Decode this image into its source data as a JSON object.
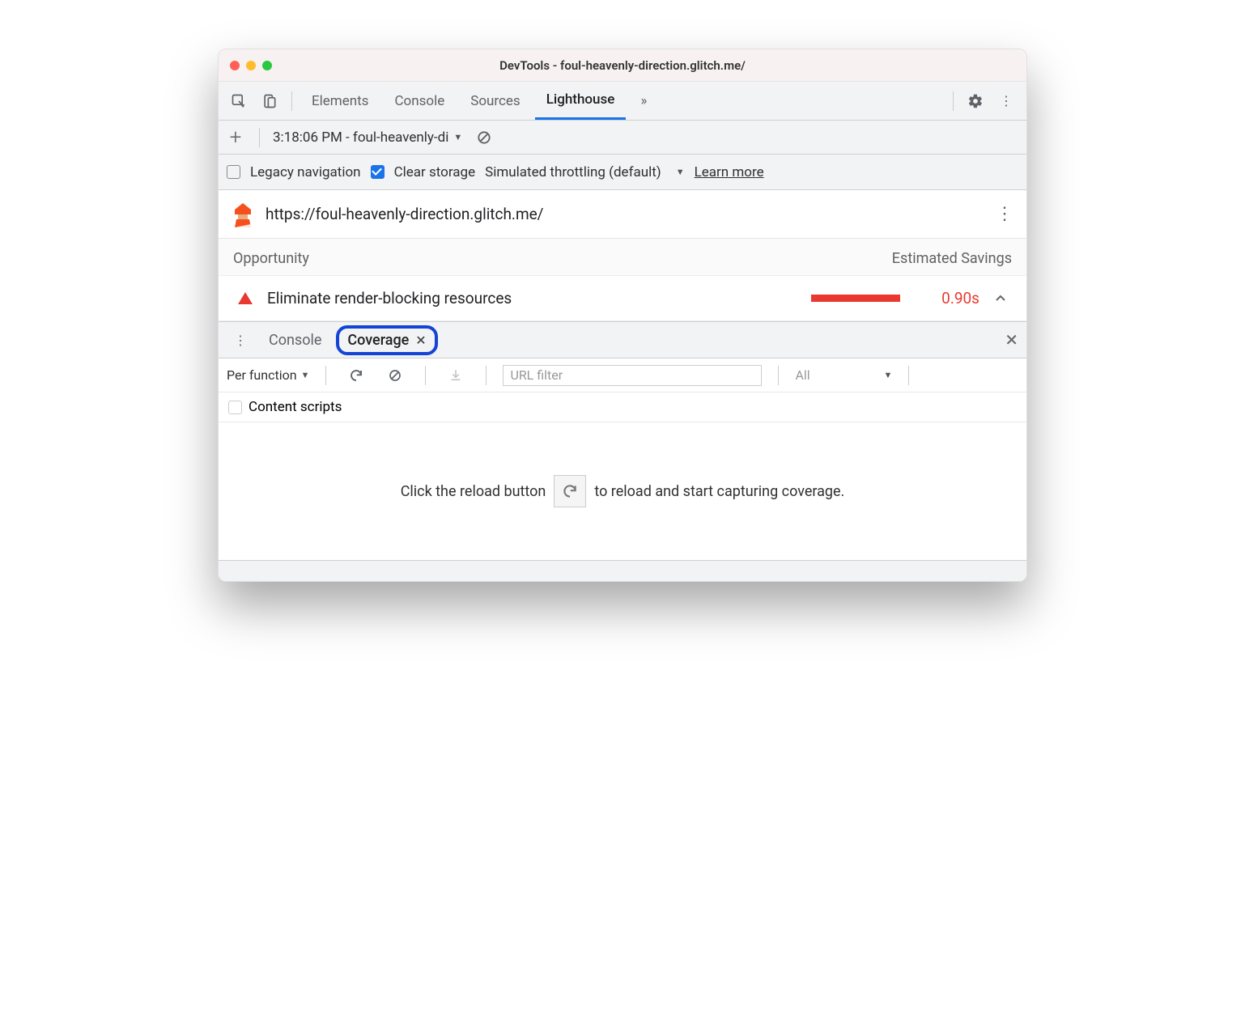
{
  "window_title": "DevTools - foul-heavenly-direction.glitch.me/",
  "tabs": {
    "elements": "Elements",
    "console": "Console",
    "sources": "Sources",
    "lighthouse": "Lighthouse"
  },
  "report_dropdown": "3:18:06 PM - foul-heavenly-di",
  "options": {
    "legacy_nav": "Legacy navigation",
    "clear_storage": "Clear storage",
    "throttling": "Simulated throttling (default)",
    "learn_more": "Learn more"
  },
  "page_url": "https://foul-heavenly-direction.glitch.me/",
  "opp_header_left": "Opportunity",
  "opp_header_right": "Estimated Savings",
  "opportunity": {
    "name": "Eliminate render-blocking resources",
    "savings": "0.90s"
  },
  "drawer": {
    "console": "Console",
    "coverage": "Coverage"
  },
  "coverage": {
    "granularity": "Per function",
    "url_filter_placeholder": "URL filter",
    "type_filter": "All",
    "content_scripts": "Content scripts",
    "hint_before": "Click the reload button",
    "hint_after": "to reload and start capturing coverage."
  }
}
